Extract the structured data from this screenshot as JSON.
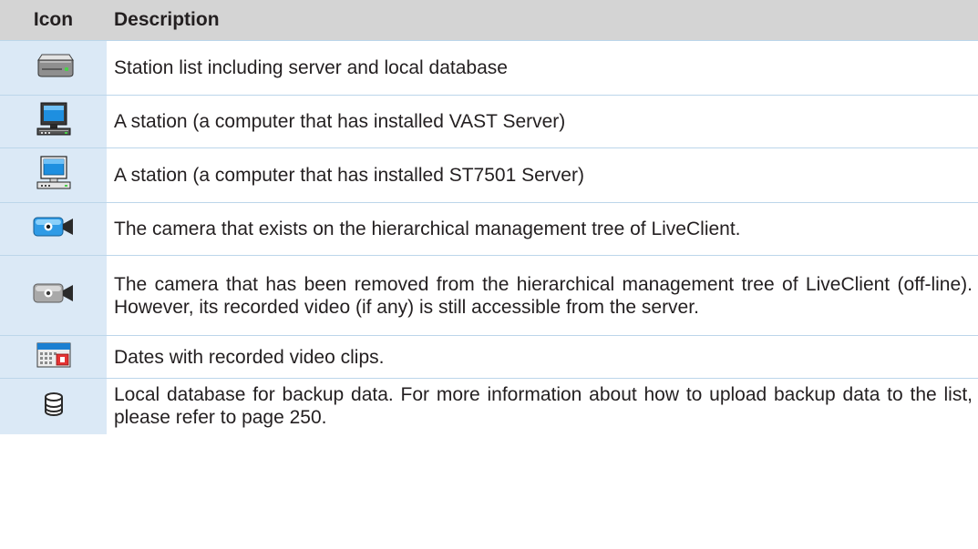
{
  "table": {
    "headers": {
      "icon": "Icon",
      "description": "Description"
    },
    "rows": [
      {
        "icon": "server-stack-icon",
        "description": "Station list including server and local database"
      },
      {
        "icon": "vast-station-computer-icon",
        "description": "A station (a computer that has installed VAST Server)"
      },
      {
        "icon": "st7501-station-computer-icon",
        "description": "A station (a computer that has installed ST7501 Server)"
      },
      {
        "icon": "camera-online-icon",
        "description": "The camera that exists on the hierarchical management tree of LiveClient."
      },
      {
        "icon": "camera-offline-icon",
        "description": "The camera that has been removed from the hierarchical management tree of LiveClient (off-line). However, its recorded video (if any) is still accessible from the server."
      },
      {
        "icon": "calendar-icon",
        "description": "Dates with recorded video clips."
      },
      {
        "icon": "database-icon",
        "description": "Local database for backup data. For more information about how to upload backup data to the list, please refer to page 250."
      }
    ]
  }
}
